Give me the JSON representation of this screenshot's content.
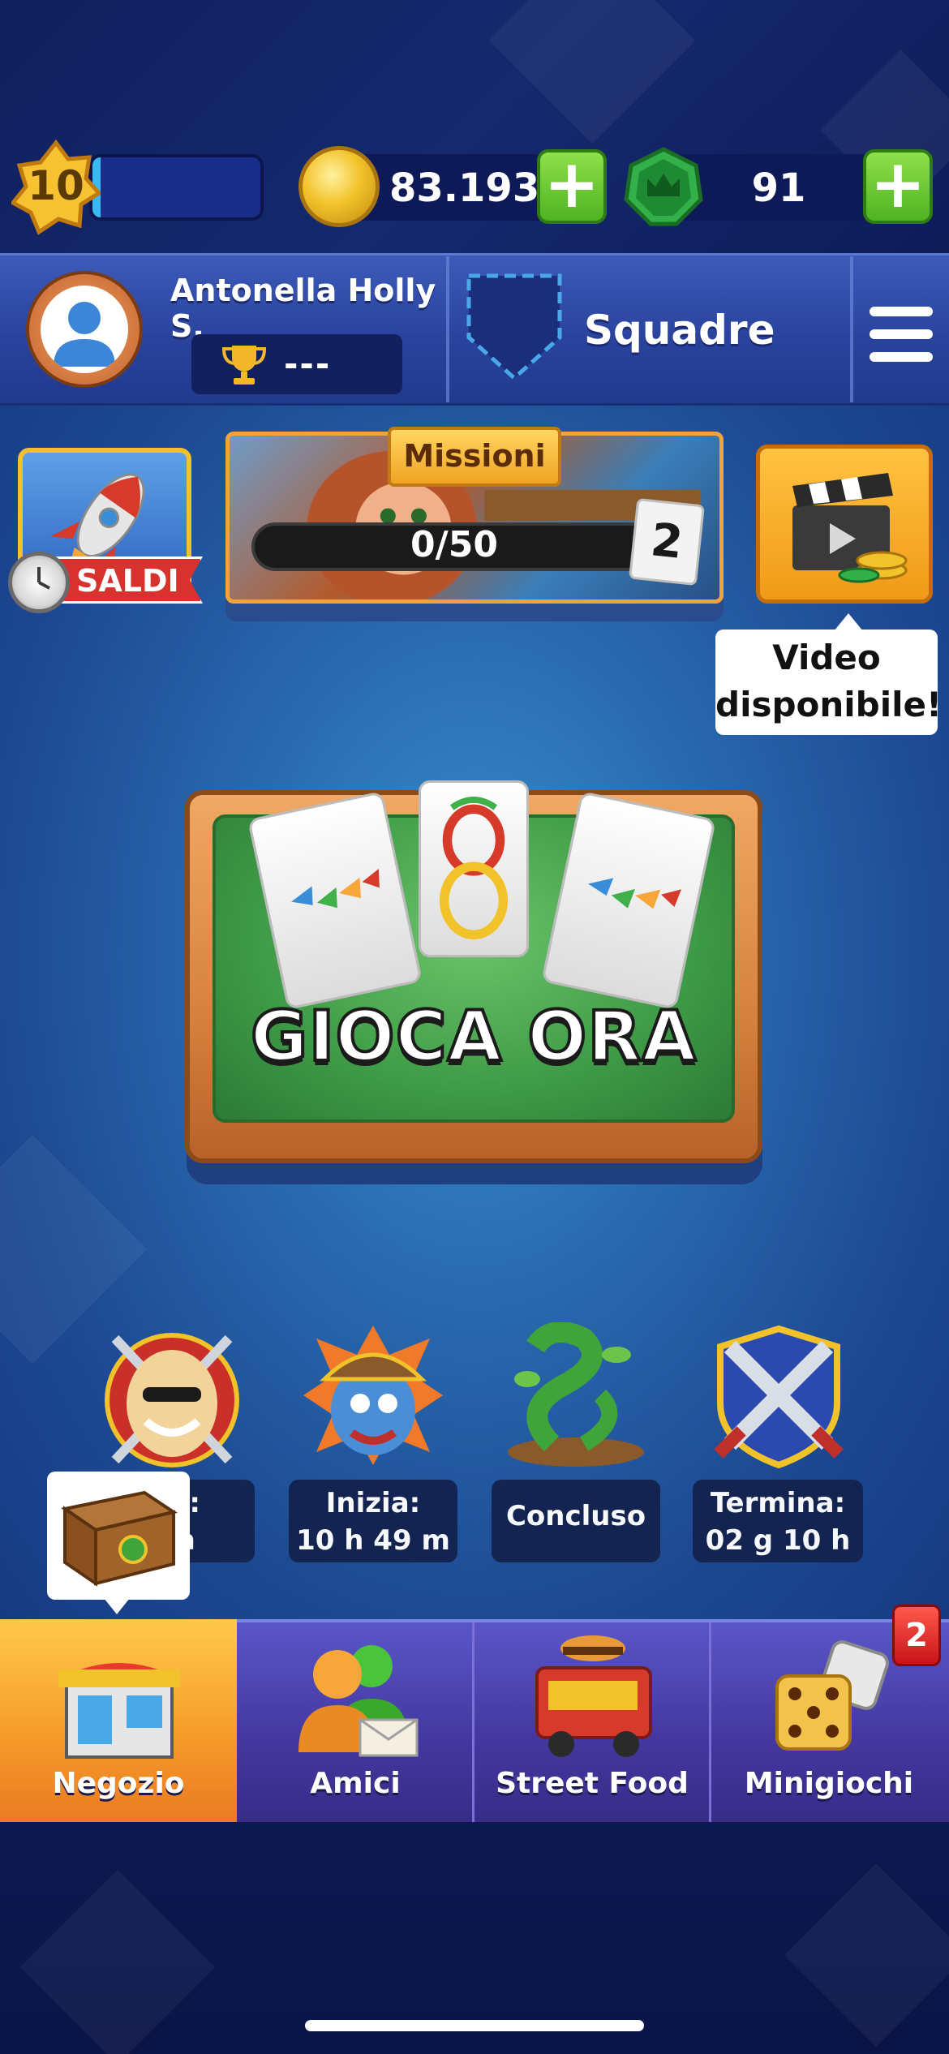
{
  "colors": {
    "accent_green": "#4fb322",
    "coin_gold": "#f2c22a",
    "gem_green": "#2e9a3a",
    "nav_active": "#f59a2a",
    "nav_bg": "#43379e",
    "badge_red": "#d01a1e"
  },
  "top_bar": {
    "level": "10",
    "coins": "83.193",
    "gems": "91",
    "plus_symbol": "+"
  },
  "profile": {
    "name": "Antonella Holly S.",
    "trophy_value": "---",
    "team_label": "Squadre"
  },
  "promos": {
    "sale_label": "SALDI",
    "missions_title": "Missioni",
    "missions_progress": "0/50",
    "missions_cards": "2",
    "video_tip_line1": "Video",
    "video_tip_line2": "disponibile!"
  },
  "play": {
    "label": "GIOCA ORA"
  },
  "events": [
    {
      "icon": "chef-icon",
      "line1": "ma:",
      "line2": "0 h"
    },
    {
      "icon": "pirate-icon",
      "line1": "Inizia:",
      "line2": "10 h 49 m"
    },
    {
      "icon": "beanstalk-icon",
      "line1": "Concluso",
      "line2": ""
    },
    {
      "icon": "crossed-swords-icon",
      "line1": "Termina:",
      "line2": "02 g 10 h"
    }
  ],
  "nav": {
    "items": [
      {
        "label": "Negozio",
        "icon": "shop-icon",
        "active": true
      },
      {
        "label": "Amici",
        "icon": "friends-icon",
        "active": false
      },
      {
        "label": "Street Food",
        "icon": "food-truck-icon",
        "active": false
      },
      {
        "label": "Minigiochi",
        "icon": "dice-icon",
        "active": false
      }
    ],
    "badge": "2"
  }
}
